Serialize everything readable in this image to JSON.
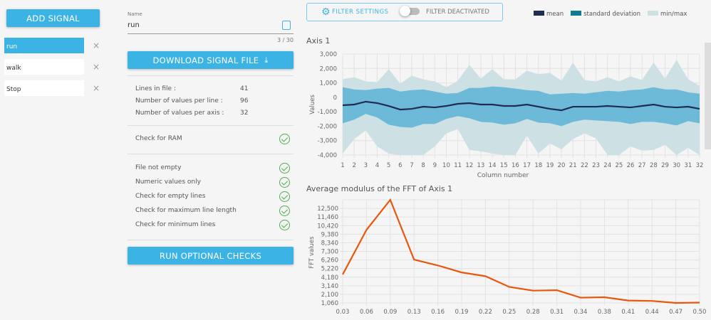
{
  "sidebar": {
    "add_label": "ADD SIGNAL",
    "signals": [
      {
        "label": "run",
        "active": true
      },
      {
        "label": "walk"
      },
      {
        "label": "Stop"
      }
    ],
    "remove_glyph": "×"
  },
  "editor": {
    "name_label": "Name",
    "name_value": "run",
    "counter": "3 / 30",
    "download_label": "DOWNLOAD SIGNAL FILE",
    "stats": [
      {
        "label": "Lines in file :",
        "value": "41"
      },
      {
        "label": "Number of values per line :",
        "value": "96"
      },
      {
        "label": "Number of values per axis :",
        "value": "32"
      }
    ],
    "ram_check": "Check for RAM",
    "checks": [
      "File not empty",
      "Numeric values only",
      "Check for empty lines",
      "Check for maximum line length",
      "Check for minimum lines"
    ],
    "run_label": "RUN OPTIONAL CHECKS"
  },
  "filter": {
    "settings_label": "FILTER SETTINGS",
    "toggle_label": "FILTER DEACTIVATED",
    "toggle_on": false
  },
  "legend": [
    {
      "label": "mean",
      "color": "#1f2d52"
    },
    {
      "label": "standard deviation",
      "color": "#0e7b93"
    },
    {
      "label": "min/max",
      "color": "#cde0e4"
    }
  ],
  "chart_data": [
    {
      "type": "area",
      "title": "Axis 1",
      "xlabel": "Column number",
      "ylabel": "Values",
      "ylim": [
        -4000,
        3000
      ],
      "yticks": [
        "3,000",
        "2,000",
        "1,000",
        "0",
        "-1,000",
        "-2,000",
        "-3,000",
        "-4,000"
      ],
      "x": [
        1,
        2,
        3,
        4,
        5,
        6,
        7,
        8,
        9,
        10,
        11,
        12,
        13,
        14,
        15,
        16,
        17,
        18,
        19,
        20,
        21,
        22,
        23,
        24,
        25,
        26,
        27,
        28,
        29,
        30,
        31,
        32
      ],
      "series": [
        {
          "name": "mean",
          "values": [
            -550,
            -500,
            -300,
            -400,
            -600,
            -850,
            -800,
            -650,
            -700,
            -600,
            -450,
            -400,
            -500,
            -500,
            -600,
            -600,
            -500,
            -650,
            -800,
            -900,
            -650,
            -650,
            -650,
            -600,
            -650,
            -700,
            -600,
            -500,
            -650,
            -700,
            -650,
            -800
          ]
        },
        {
          "name": "standard deviation",
          "upper": [
            700,
            550,
            500,
            600,
            650,
            400,
            500,
            550,
            400,
            250,
            300,
            650,
            650,
            750,
            700,
            600,
            500,
            450,
            200,
            250,
            300,
            250,
            350,
            450,
            400,
            500,
            550,
            700,
            550,
            550,
            350,
            250
          ],
          "lower": [
            -1800,
            -1550,
            -1150,
            -1400,
            -1900,
            -2050,
            -2100,
            -1850,
            -1850,
            -1500,
            -1300,
            -1450,
            -1700,
            -1750,
            -1900,
            -1800,
            -1500,
            -1750,
            -1800,
            -2000,
            -1700,
            -1550,
            -1600,
            -1650,
            -1700,
            -1850,
            -1700,
            -1700,
            -1800,
            -1950,
            -1650,
            -1800
          ]
        },
        {
          "name": "min/max",
          "upper": [
            1250,
            1400,
            1100,
            1050,
            1950,
            950,
            1500,
            1250,
            1100,
            700,
            1150,
            2250,
            1300,
            1950,
            1250,
            1250,
            1850,
            1600,
            1700,
            1150,
            2400,
            1200,
            1100,
            1400,
            1100,
            1450,
            1200,
            2400,
            1300,
            2600,
            1250,
            800
          ],
          "lower": [
            -3900,
            -2900,
            -2300,
            -3400,
            -3900,
            -4000,
            -4000,
            -4000,
            -3400,
            -2500,
            -2200,
            -3650,
            -3750,
            -3900,
            -4000,
            -4000,
            -2650,
            -3900,
            -3200,
            -3600,
            -2900,
            -2500,
            -2850,
            -4000,
            -4000,
            -3400,
            -3700,
            -3650,
            -3300,
            -4000,
            -3500,
            -4000
          ]
        }
      ]
    },
    {
      "type": "line",
      "title": "Average modulus of the FFT of Axis 1",
      "xlabel": "",
      "ylabel": "FFT values",
      "ylim": [
        1060,
        13540
      ],
      "color": "#e8560c",
      "yticks": [
        "12,500",
        "11,460",
        "10,420",
        "9,380",
        "8,340",
        "7,300",
        "6,260",
        "5,220",
        "4,180",
        "3,140",
        "2,100",
        "1,060"
      ],
      "x": [
        "0.03",
        "0.06",
        "0.09",
        "0.13",
        "0.16",
        "0.19",
        "0.22",
        "0.25",
        "0.28",
        "0.31",
        "0.34",
        "0.38",
        "0.41",
        "0.44",
        "0.47",
        "0.50"
      ],
      "values": [
        4500,
        9900,
        13540,
        6300,
        5600,
        4750,
        4300,
        3000,
        2550,
        2600,
        1700,
        1750,
        1350,
        1300,
        1060,
        1100
      ]
    }
  ]
}
